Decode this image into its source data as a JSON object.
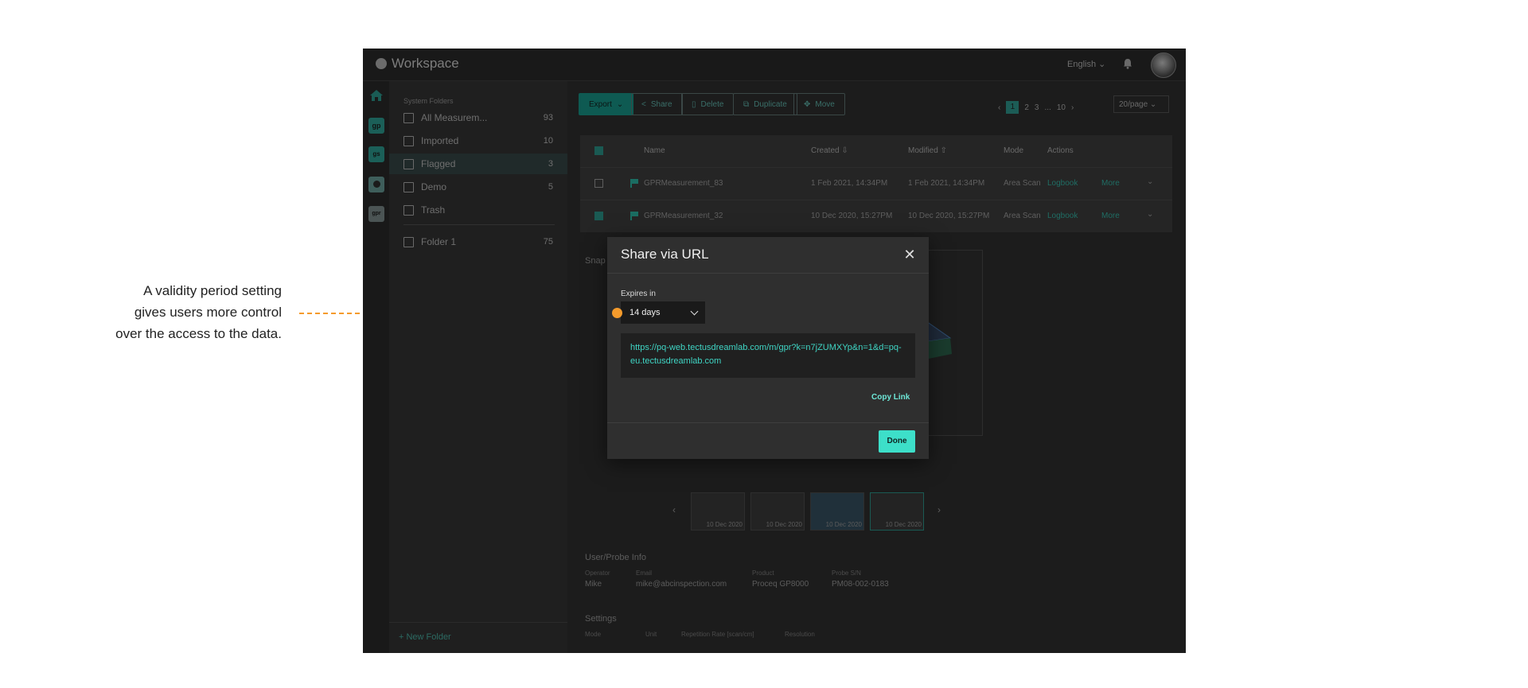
{
  "annotation": {
    "line1": "A validity period setting",
    "line2": "gives users more control",
    "line3": "over the access to the data.",
    "accent_color": "#f59b2c"
  },
  "header": {
    "app_title": "Workspace",
    "language": "English",
    "bell_icon": "bell-icon",
    "avatar_icon": "user-avatar"
  },
  "rail": {
    "items": [
      "home-icon",
      "gp",
      "gs",
      "pm-icon",
      "gpr"
    ]
  },
  "sidebar": {
    "section_label": "System Folders",
    "items": [
      {
        "label": "All Measurem...",
        "count": "93",
        "icon": "file-icon"
      },
      {
        "label": "Imported",
        "count": "10",
        "icon": "import-icon"
      },
      {
        "label": "Flagged",
        "count": "3",
        "icon": "flag-icon"
      },
      {
        "label": "Demo",
        "count": "5",
        "icon": "folder-icon"
      },
      {
        "label": "Trash",
        "count": "",
        "icon": "trash-icon"
      },
      {
        "label": "Folder 1",
        "count": "75",
        "icon": "folder-icon"
      }
    ],
    "new_folder": "+ New Folder"
  },
  "toolbar": {
    "export": "Export",
    "share": "Share",
    "delete": "Delete",
    "duplicate": "Duplicate",
    "move": "Move"
  },
  "pagination": {
    "pages": [
      "1",
      "2",
      "3",
      "...",
      "10"
    ],
    "current": "1",
    "per_page": "20/page"
  },
  "table": {
    "columns": [
      "Name",
      "Created ⇩",
      "Modified ⇧",
      "Mode",
      "Actions"
    ],
    "rows": [
      {
        "name": "GPRMeasurement_83",
        "created": "1 Feb 2021, 14:34PM",
        "modified": "1 Feb 2021, 14:34PM",
        "mode": "Area Scan",
        "logbook": "Logbook",
        "more": "More",
        "checked": false
      },
      {
        "name": "GPRMeasurement_32",
        "created": "10 Dec 2020, 15:27PM",
        "modified": "10 Dec 2020, 15:27PM",
        "mode": "Area Scan",
        "logbook": "Logbook",
        "more": "More",
        "checked": true
      }
    ]
  },
  "detail": {
    "snapshots_label": "Snap",
    "thumbnails": [
      "10 Dec 2020",
      "10 Dec 2020",
      "10 Dec 2020",
      "10 Dec 2020"
    ],
    "user_probe_title": "User/Probe Info",
    "operator_label": "Operator",
    "operator": "Mike",
    "email_label": "Email",
    "email": "mike@abcinspection.com",
    "product_label": "Product",
    "product": "Proceq GP8000",
    "probe_label": "Probe S/N",
    "probe": "PM08-002-0183",
    "settings_title": "Settings",
    "settings_cols": [
      "Mode",
      "Unit",
      "Repetition Rate [scan/cm]",
      "Resolution"
    ]
  },
  "modal": {
    "title": "Share via URL",
    "expires_label": "Expires in",
    "expires_value": "14 days",
    "url": "https://pq-web.tectusdreamlab.com/m/gpr?k=n7jZUMXYp&n=1&d=pq-eu.tectusdreamlab.com",
    "copy_label": "Copy Link",
    "done_label": "Done",
    "accent_color": "#3ddfc9"
  }
}
